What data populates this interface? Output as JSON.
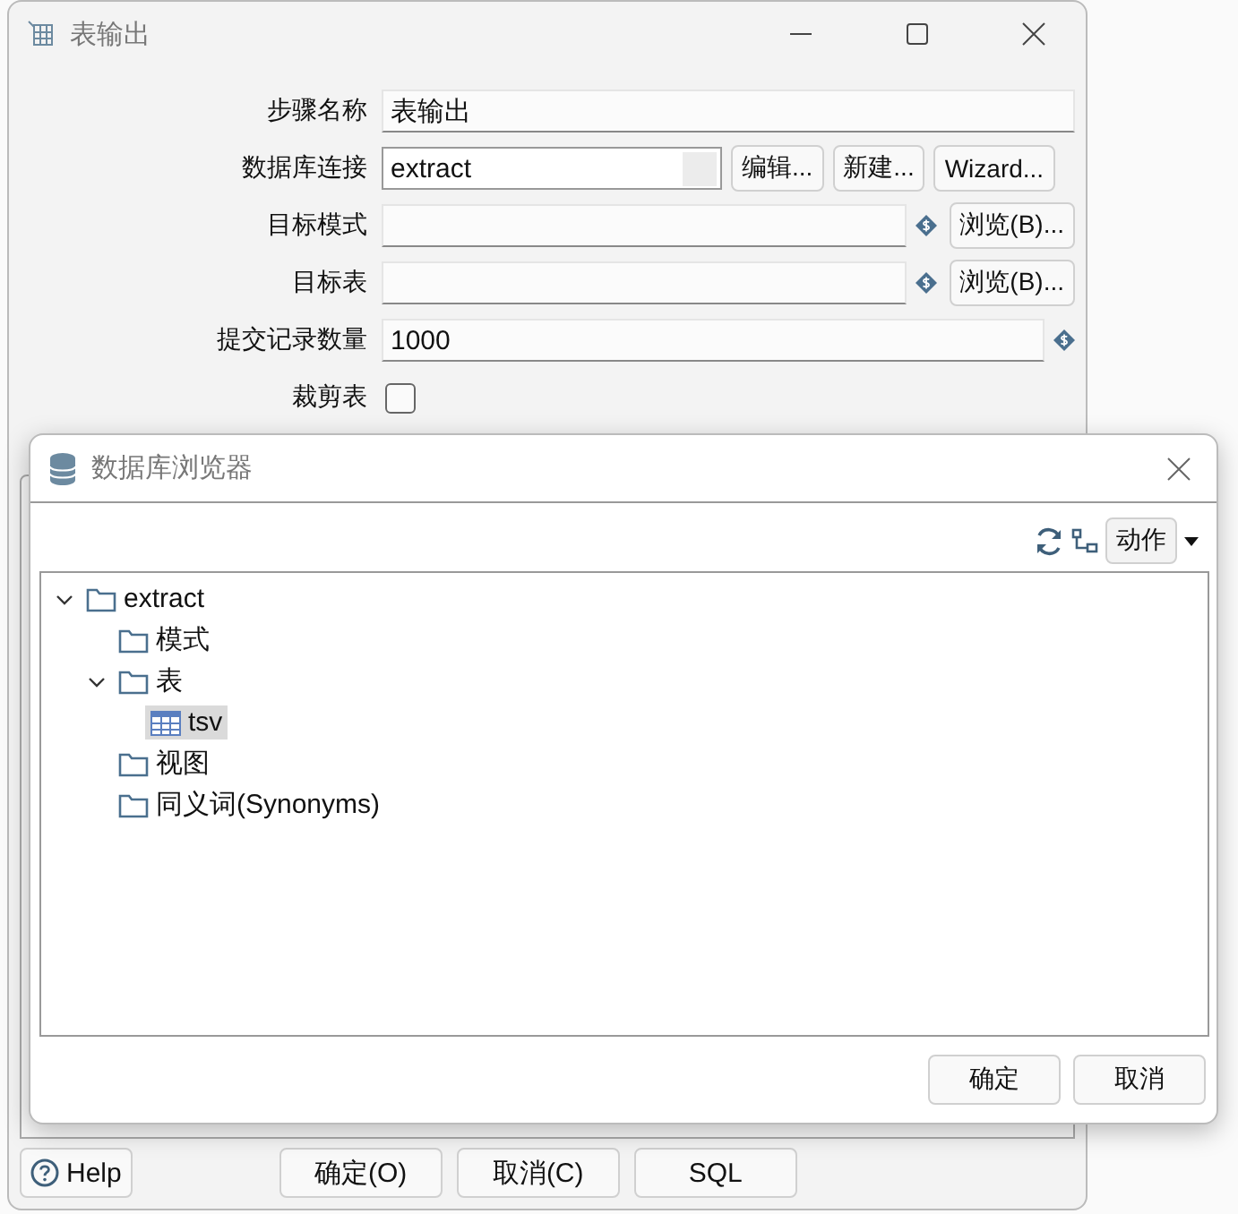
{
  "main_window": {
    "title": "表输出",
    "fields": [
      {
        "label": "步骤名称",
        "kind": "text",
        "value": "表输出"
      },
      {
        "label": "数据库连接",
        "kind": "combo",
        "value": "extract",
        "buttons": [
          "编辑...",
          "新建...",
          "Wizard..."
        ]
      },
      {
        "label": "目标模式",
        "kind": "variable",
        "buttons": [
          "浏览(B)..."
        ]
      },
      {
        "label": "目标表",
        "kind": "variable",
        "buttons": [
          "浏览(B)..."
        ]
      },
      {
        "label": "提交记录数量",
        "kind": "variable",
        "value": "1000"
      },
      {
        "label": "裁剪表",
        "kind": "checkbox",
        "checked": false
      }
    ],
    "buttons": [
      {
        "label": "Help",
        "kind": "help"
      },
      {
        "label": "确定(O)",
        "kind": "plain"
      },
      {
        "label": "取消(C)",
        "kind": "plain"
      },
      {
        "label": "SQL",
        "kind": "plain"
      }
    ]
  },
  "dialog": {
    "title": "数据库浏览器",
    "action_menu": "动作",
    "tree": [
      {
        "label": "extract",
        "kind": "folder",
        "expanded": true,
        "selected": false,
        "children": [
          {
            "label": "模式",
            "kind": "folder",
            "selected": false
          },
          {
            "label": "表",
            "kind": "folder",
            "expanded": true,
            "selected": false,
            "children": [
              {
                "label": "tsv",
                "kind": "table",
                "selected": true
              }
            ]
          },
          {
            "label": "视图",
            "kind": "folder",
            "selected": false
          },
          {
            "label": "同义词(Synonyms)",
            "kind": "folder",
            "selected": false
          }
        ]
      }
    ],
    "buttons": [
      "确定",
      "取消"
    ]
  }
}
